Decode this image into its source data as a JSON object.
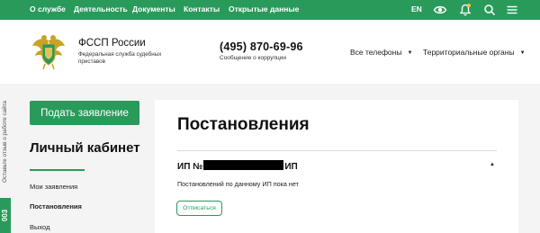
{
  "topnav": {
    "items": [
      "О службе",
      "Деятельность",
      "Документы",
      "Контакты",
      "Открытые данные"
    ],
    "lang": "EN",
    "icons": [
      "eye-icon",
      "bell-icon",
      "search-icon",
      "menu-icon"
    ]
  },
  "header": {
    "org_title": "ФССП России",
    "org_subtitle": "Федеральная служба судебных приставов",
    "phone": "(495) 870-69-96",
    "phone_sub": "Сообщение о коррупции",
    "all_phones": "Все телефоны",
    "territorial": "Территориальные органы"
  },
  "side": {
    "feedback": "Оставьте отзыв о работе сайта",
    "badge": "003"
  },
  "sidebar": {
    "apply_button": "Подать заявление",
    "cabinet_title": "Личный кабинет",
    "menu": [
      "Мои заявления",
      "Постановления",
      "Выход"
    ],
    "active_index": 1
  },
  "main": {
    "title": "Постановления",
    "ip_prefix": "ИП №",
    "ip_suffix": "ИП",
    "empty_text": "Постановлений по данному ИП пока нет",
    "unsubscribe": "Отписаться"
  },
  "colors": {
    "brand_green": "#2a9a5b",
    "notification_dot": "#f4c531"
  }
}
